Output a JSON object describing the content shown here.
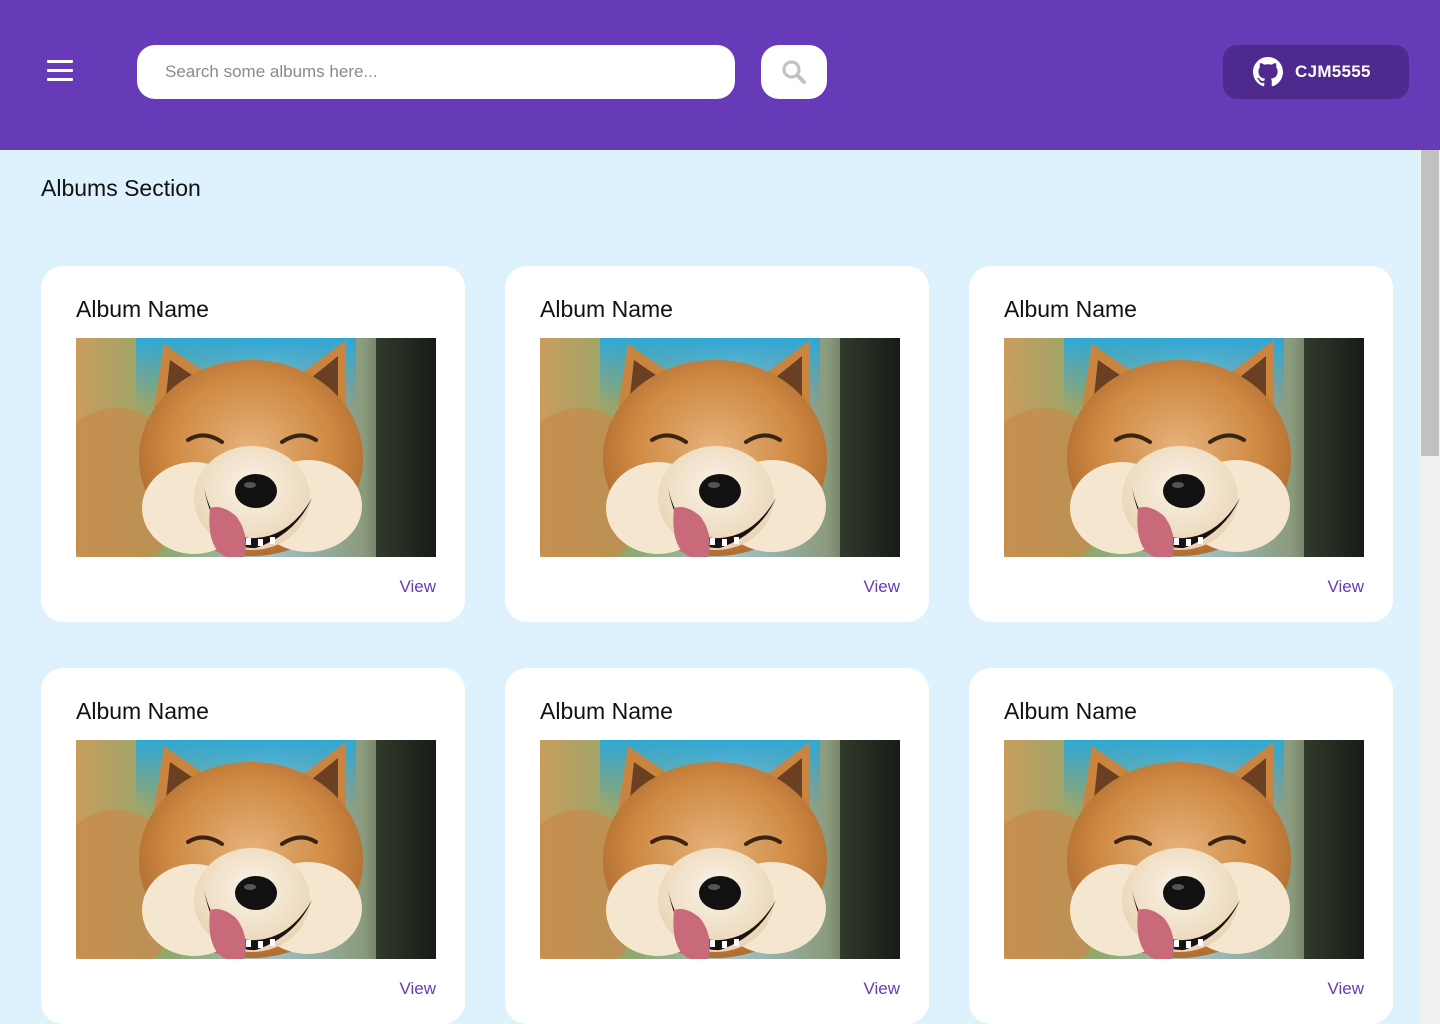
{
  "header": {
    "search": {
      "placeholder": "Search some albums here...",
      "value": ""
    },
    "github_user": "CJM5555",
    "menu_icon": "hamburger-menu-icon",
    "search_icon": "search-icon",
    "github_icon": "github-icon"
  },
  "colors": {
    "header_bg": "#673ab7",
    "page_bg": "#ddf2fd",
    "github_button_bg": "#4e2a8e",
    "link": "#673ab7"
  },
  "main": {
    "section_title": "Albums Section",
    "albums": [
      {
        "name": "Album Name",
        "view_label": "View",
        "image": "shiba-inu-dog-photo"
      },
      {
        "name": "Album Name",
        "view_label": "View",
        "image": "shiba-inu-dog-photo"
      },
      {
        "name": "Album Name",
        "view_label": "View",
        "image": "shiba-inu-dog-photo"
      },
      {
        "name": "Album Name",
        "view_label": "View",
        "image": "shiba-inu-dog-photo"
      },
      {
        "name": "Album Name",
        "view_label": "View",
        "image": "shiba-inu-dog-photo"
      },
      {
        "name": "Album Name",
        "view_label": "View",
        "image": "shiba-inu-dog-photo"
      }
    ]
  }
}
